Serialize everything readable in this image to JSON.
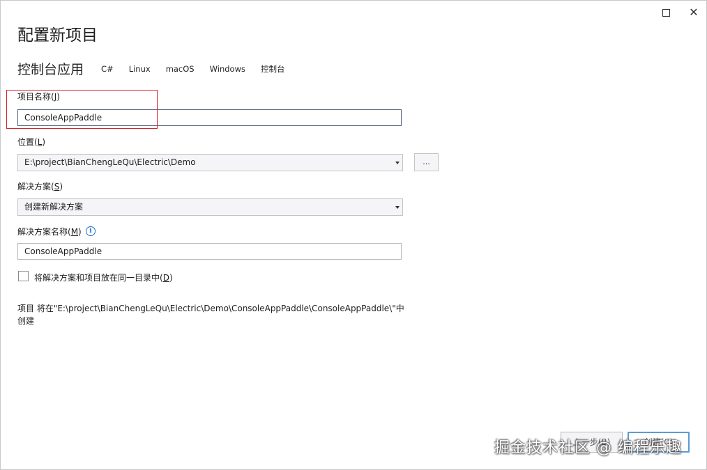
{
  "window": {
    "maximize_icon": "maximize-icon",
    "close_icon": "close-icon",
    "close_glyph": "✕"
  },
  "page": {
    "title": "配置新项目",
    "subtitle": "控制台应用",
    "tags": [
      "C#",
      "Linux",
      "macOS",
      "Windows",
      "控制台"
    ]
  },
  "project_name": {
    "label": "项目名称(",
    "accel": "J",
    "label_end": ")",
    "value": "ConsoleAppPaddle"
  },
  "location": {
    "label": "位置(",
    "accel": "L",
    "label_end": ")",
    "value": "E:\\project\\BianChengLeQu\\Electric\\Demo",
    "browse_label": "..."
  },
  "solution": {
    "label": "解决方案(",
    "accel": "S",
    "label_end": ")",
    "value": "创建新解决方案"
  },
  "solution_name": {
    "label": "解决方案名称(",
    "accel": "M",
    "label_end": ")",
    "info_glyph": "i",
    "value": "ConsoleAppPaddle"
  },
  "same_dir": {
    "label": "将解决方案和项目放在同一目录中(",
    "accel": "D",
    "label_end": ")",
    "checked": false
  },
  "path_info": "项目 将在\"E:\\project\\BianChengLeQu\\Electric\\Demo\\ConsoleAppPaddle\\ConsoleAppPaddle\\\"中创建",
  "footer": {
    "back_label": "上一步(B)",
    "create_label": "创建(C)"
  },
  "watermark": "掘金技术社区 @ 编程乐趣",
  "colors": {
    "highlight": "#d3242c",
    "info": "#1a6fc9",
    "primary_border": "#5b9bd5"
  }
}
